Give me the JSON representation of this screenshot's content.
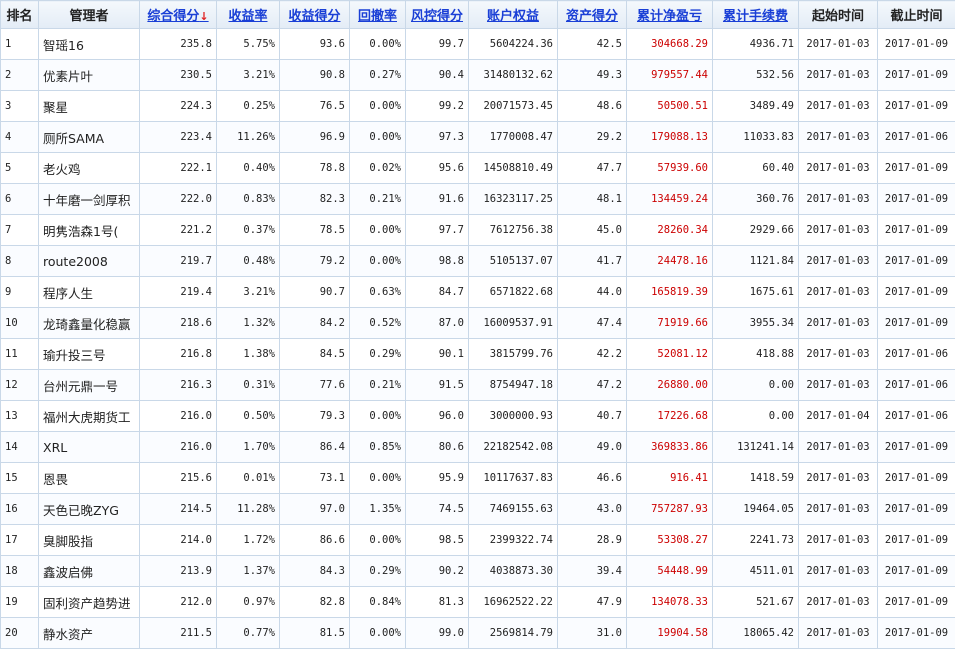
{
  "headers": {
    "rank": "排名",
    "manager": "管理者",
    "composite": "综合得分",
    "sort_arrow": "↓",
    "return_rate": "收益率",
    "return_score": "收益得分",
    "drawdown": "回撤率",
    "risk_score": "风控得分",
    "equity": "账户权益",
    "asset_score": "资产得分",
    "cum_pnl": "累计净盈亏",
    "cum_fee": "累计手续费",
    "start": "起始时间",
    "end": "截止时间"
  },
  "colors": {
    "link": "#1a3fd6",
    "profit_red": "#cc0000",
    "border": "#c9d8e8"
  },
  "rows": [
    {
      "rank": "1",
      "manager": "智瑶16",
      "composite": "235.8",
      "return_rate": "5.75%",
      "return_score": "93.6",
      "drawdown": "0.00%",
      "risk_score": "99.7",
      "equity": "5604224.36",
      "asset_score": "42.5",
      "cum_pnl": "304668.29",
      "cum_fee": "4936.71",
      "start": "2017-01-03",
      "end": "2017-01-09"
    },
    {
      "rank": "2",
      "manager": "优素片叶",
      "composite": "230.5",
      "return_rate": "3.21%",
      "return_score": "90.8",
      "drawdown": "0.27%",
      "risk_score": "90.4",
      "equity": "31480132.62",
      "asset_score": "49.3",
      "cum_pnl": "979557.44",
      "cum_fee": "532.56",
      "start": "2017-01-03",
      "end": "2017-01-09"
    },
    {
      "rank": "3",
      "manager": "聚星",
      "composite": "224.3",
      "return_rate": "0.25%",
      "return_score": "76.5",
      "drawdown": "0.00%",
      "risk_score": "99.2",
      "equity": "20071573.45",
      "asset_score": "48.6",
      "cum_pnl": "50500.51",
      "cum_fee": "3489.49",
      "start": "2017-01-03",
      "end": "2017-01-09"
    },
    {
      "rank": "4",
      "manager": "厕所SAMA",
      "composite": "223.4",
      "return_rate": "11.26%",
      "return_score": "96.9",
      "drawdown": "0.00%",
      "risk_score": "97.3",
      "equity": "1770008.47",
      "asset_score": "29.2",
      "cum_pnl": "179088.13",
      "cum_fee": "11033.83",
      "start": "2017-01-03",
      "end": "2017-01-06"
    },
    {
      "rank": "5",
      "manager": "老火鸡",
      "composite": "222.1",
      "return_rate": "0.40%",
      "return_score": "78.8",
      "drawdown": "0.02%",
      "risk_score": "95.6",
      "equity": "14508810.49",
      "asset_score": "47.7",
      "cum_pnl": "57939.60",
      "cum_fee": "60.40",
      "start": "2017-01-03",
      "end": "2017-01-09"
    },
    {
      "rank": "6",
      "manager": "十年磨一剑厚积",
      "composite": "222.0",
      "return_rate": "0.83%",
      "return_score": "82.3",
      "drawdown": "0.21%",
      "risk_score": "91.6",
      "equity": "16323117.25",
      "asset_score": "48.1",
      "cum_pnl": "134459.24",
      "cum_fee": "360.76",
      "start": "2017-01-03",
      "end": "2017-01-09"
    },
    {
      "rank": "7",
      "manager": "明隽浩森1号(",
      "composite": "221.2",
      "return_rate": "0.37%",
      "return_score": "78.5",
      "drawdown": "0.00%",
      "risk_score": "97.7",
      "equity": "7612756.38",
      "asset_score": "45.0",
      "cum_pnl": "28260.34",
      "cum_fee": "2929.66",
      "start": "2017-01-03",
      "end": "2017-01-09"
    },
    {
      "rank": "8",
      "manager": "route2008",
      "composite": "219.7",
      "return_rate": "0.48%",
      "return_score": "79.2",
      "drawdown": "0.00%",
      "risk_score": "98.8",
      "equity": "5105137.07",
      "asset_score": "41.7",
      "cum_pnl": "24478.16",
      "cum_fee": "1121.84",
      "start": "2017-01-03",
      "end": "2017-01-09"
    },
    {
      "rank": "9",
      "manager": "程序人生",
      "composite": "219.4",
      "return_rate": "3.21%",
      "return_score": "90.7",
      "drawdown": "0.63%",
      "risk_score": "84.7",
      "equity": "6571822.68",
      "asset_score": "44.0",
      "cum_pnl": "165819.39",
      "cum_fee": "1675.61",
      "start": "2017-01-03",
      "end": "2017-01-09"
    },
    {
      "rank": "10",
      "manager": "龙琦鑫量化稳赢",
      "composite": "218.6",
      "return_rate": "1.32%",
      "return_score": "84.2",
      "drawdown": "0.52%",
      "risk_score": "87.0",
      "equity": "16009537.91",
      "asset_score": "47.4",
      "cum_pnl": "71919.66",
      "cum_fee": "3955.34",
      "start": "2017-01-03",
      "end": "2017-01-09"
    },
    {
      "rank": "11",
      "manager": "瑜升投三号",
      "composite": "216.8",
      "return_rate": "1.38%",
      "return_score": "84.5",
      "drawdown": "0.29%",
      "risk_score": "90.1",
      "equity": "3815799.76",
      "asset_score": "42.2",
      "cum_pnl": "52081.12",
      "cum_fee": "418.88",
      "start": "2017-01-03",
      "end": "2017-01-06"
    },
    {
      "rank": "12",
      "manager": "台州元鼎一号",
      "composite": "216.3",
      "return_rate": "0.31%",
      "return_score": "77.6",
      "drawdown": "0.21%",
      "risk_score": "91.5",
      "equity": "8754947.18",
      "asset_score": "47.2",
      "cum_pnl": "26880.00",
      "cum_fee": "0.00",
      "start": "2017-01-03",
      "end": "2017-01-06"
    },
    {
      "rank": "13",
      "manager": "福州大虎期货工",
      "composite": "216.0",
      "return_rate": "0.50%",
      "return_score": "79.3",
      "drawdown": "0.00%",
      "risk_score": "96.0",
      "equity": "3000000.93",
      "asset_score": "40.7",
      "cum_pnl": "17226.68",
      "cum_fee": "0.00",
      "start": "2017-01-04",
      "end": "2017-01-06"
    },
    {
      "rank": "14",
      "manager": "XRL",
      "composite": "216.0",
      "return_rate": "1.70%",
      "return_score": "86.4",
      "drawdown": "0.85%",
      "risk_score": "80.6",
      "equity": "22182542.08",
      "asset_score": "49.0",
      "cum_pnl": "369833.86",
      "cum_fee": "131241.14",
      "start": "2017-01-03",
      "end": "2017-01-09"
    },
    {
      "rank": "15",
      "manager": "恩畏",
      "composite": "215.6",
      "return_rate": "0.01%",
      "return_score": "73.1",
      "drawdown": "0.00%",
      "risk_score": "95.9",
      "equity": "10117637.83",
      "asset_score": "46.6",
      "cum_pnl": "916.41",
      "cum_fee": "1418.59",
      "start": "2017-01-03",
      "end": "2017-01-09"
    },
    {
      "rank": "16",
      "manager": "天色已晚ZYG",
      "composite": "214.5",
      "return_rate": "11.28%",
      "return_score": "97.0",
      "drawdown": "1.35%",
      "risk_score": "74.5",
      "equity": "7469155.63",
      "asset_score": "43.0",
      "cum_pnl": "757287.93",
      "cum_fee": "19464.05",
      "start": "2017-01-03",
      "end": "2017-01-09"
    },
    {
      "rank": "17",
      "manager": "臭脚股指",
      "composite": "214.0",
      "return_rate": "1.72%",
      "return_score": "86.6",
      "drawdown": "0.00%",
      "risk_score": "98.5",
      "equity": "2399322.74",
      "asset_score": "28.9",
      "cum_pnl": "53308.27",
      "cum_fee": "2241.73",
      "start": "2017-01-03",
      "end": "2017-01-09"
    },
    {
      "rank": "18",
      "manager": "鑫波启佛",
      "composite": "213.9",
      "return_rate": "1.37%",
      "return_score": "84.3",
      "drawdown": "0.29%",
      "risk_score": "90.2",
      "equity": "4038873.30",
      "asset_score": "39.4",
      "cum_pnl": "54448.99",
      "cum_fee": "4511.01",
      "start": "2017-01-03",
      "end": "2017-01-09"
    },
    {
      "rank": "19",
      "manager": "固利资产趋势进",
      "composite": "212.0",
      "return_rate": "0.97%",
      "return_score": "82.8",
      "drawdown": "0.84%",
      "risk_score": "81.3",
      "equity": "16962522.22",
      "asset_score": "47.9",
      "cum_pnl": "134078.33",
      "cum_fee": "521.67",
      "start": "2017-01-03",
      "end": "2017-01-09"
    },
    {
      "rank": "20",
      "manager": "静水资产",
      "composite": "211.5",
      "return_rate": "0.77%",
      "return_score": "81.5",
      "drawdown": "0.00%",
      "risk_score": "99.0",
      "equity": "2569814.79",
      "asset_score": "31.0",
      "cum_pnl": "19904.58",
      "cum_fee": "18065.42",
      "start": "2017-01-03",
      "end": "2017-01-09"
    }
  ]
}
